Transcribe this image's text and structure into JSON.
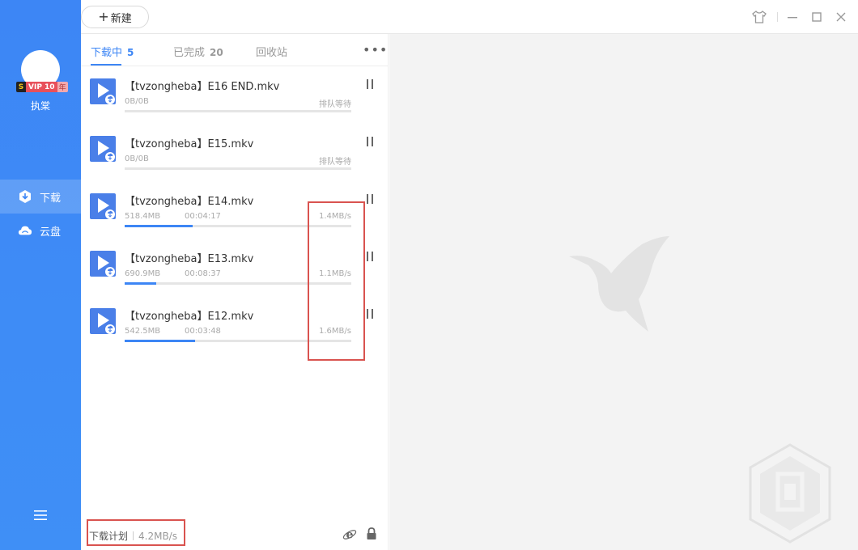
{
  "user": {
    "name": "执棠",
    "vip_s": "S",
    "vip_label": "VIP 10",
    "vip_suffix": "年"
  },
  "nav": {
    "items": [
      {
        "label": "下载",
        "icon": "download-icon",
        "active": true
      },
      {
        "label": "云盘",
        "icon": "cloud-icon",
        "active": false
      }
    ]
  },
  "toolbar": {
    "new_label": "新建"
  },
  "tabs": [
    {
      "label": "下载中",
      "count": "5",
      "active": true
    },
    {
      "label": "已完成",
      "count": "20",
      "active": false
    },
    {
      "label": "回收站",
      "count": "",
      "active": false
    }
  ],
  "tasks": [
    {
      "name": "【tvzongheba】E16 END.mkv",
      "size": "0B/0B",
      "eta": "",
      "status": "排队等待",
      "progress": 0
    },
    {
      "name": "【tvzongheba】E15.mkv",
      "size": "0B/0B",
      "eta": "",
      "status": "排队等待",
      "progress": 0
    },
    {
      "name": "【tvzongheba】E14.mkv",
      "size": "518.4MB",
      "eta": "00:04:17",
      "status": "1.4MB/s",
      "progress": 0.3
    },
    {
      "name": "【tvzongheba】E13.mkv",
      "size": "690.9MB",
      "eta": "00:08:37",
      "status": "1.1MB/s",
      "progress": 0.14
    },
    {
      "name": "【tvzongheba】E12.mkv",
      "size": "542.5MB",
      "eta": "00:03:48",
      "status": "1.6MB/s",
      "progress": 0.31
    }
  ],
  "footer": {
    "plan_label": "下载计划",
    "total_speed": "4.2MB/s"
  },
  "colors": {
    "accent": "#3d86f5",
    "highlight_box": "#d9534f"
  }
}
